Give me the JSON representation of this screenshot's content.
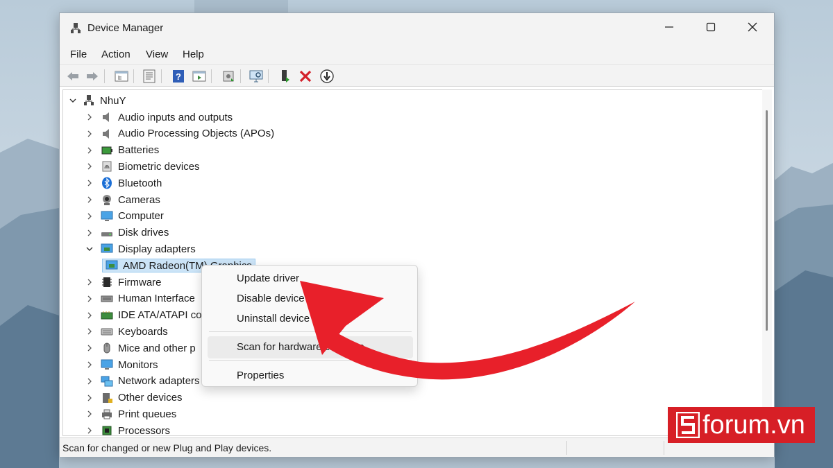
{
  "window": {
    "title": "Device Manager"
  },
  "menu": [
    "File",
    "Action",
    "View",
    "Help"
  ],
  "toolbar": [
    "back-icon",
    "forward-icon",
    "show-hide-tree-icon",
    "properties-icon",
    "help-icon",
    "action-pane-icon",
    "update-driver-icon",
    "scan-hardware-icon",
    "add-legacy-icon",
    "uninstall-icon",
    "disable-icon"
  ],
  "tree": {
    "root": "NhuY",
    "items": [
      {
        "label": "Audio inputs and outputs",
        "icon": "speaker-icon",
        "expanded": false
      },
      {
        "label": "Audio Processing Objects (APOs)",
        "icon": "speaker-icon",
        "expanded": false
      },
      {
        "label": "Batteries",
        "icon": "battery-icon",
        "expanded": false
      },
      {
        "label": "Biometric devices",
        "icon": "fingerprint-icon",
        "expanded": false
      },
      {
        "label": "Bluetooth",
        "icon": "bluetooth-icon",
        "expanded": false
      },
      {
        "label": "Cameras",
        "icon": "camera-icon",
        "expanded": false
      },
      {
        "label": "Computer",
        "icon": "computer-icon",
        "expanded": false
      },
      {
        "label": "Disk drives",
        "icon": "disk-icon",
        "expanded": false
      },
      {
        "label": "Display adapters",
        "icon": "display-adapter-icon",
        "expanded": true
      },
      {
        "label": "AMD Radeon(TM) Graphics",
        "icon": "display-adapter-icon",
        "child": true,
        "selected": true
      },
      {
        "label": "Firmware",
        "icon": "chip-icon",
        "expanded": false
      },
      {
        "label": "Human Interface",
        "icon": "hid-icon",
        "expanded": false
      },
      {
        "label": "IDE ATA/ATAPI con",
        "icon": "ide-icon",
        "expanded": false
      },
      {
        "label": "Keyboards",
        "icon": "keyboard-icon",
        "expanded": false
      },
      {
        "label": "Mice and other p",
        "icon": "mouse-icon",
        "expanded": false
      },
      {
        "label": "Monitors",
        "icon": "monitor-icon",
        "expanded": false
      },
      {
        "label": "Network adapters",
        "icon": "network-icon",
        "expanded": false
      },
      {
        "label": "Other devices",
        "icon": "unknown-device-icon",
        "expanded": false
      },
      {
        "label": "Print queues",
        "icon": "printer-icon",
        "expanded": false
      },
      {
        "label": "Processors",
        "icon": "processor-icon",
        "expanded": false
      }
    ]
  },
  "context_menu": {
    "items": [
      "Update driver",
      "Disable device",
      "Uninstall device",
      "Scan for hardware changes",
      "Properties"
    ]
  },
  "status": {
    "text": "Scan for changed or new Plug and Play devices."
  },
  "watermark": {
    "text": "forum.vn",
    "color": "#d71f26"
  },
  "colors": {
    "accent_red": "#e8202a",
    "selection": "#cce4f7"
  }
}
